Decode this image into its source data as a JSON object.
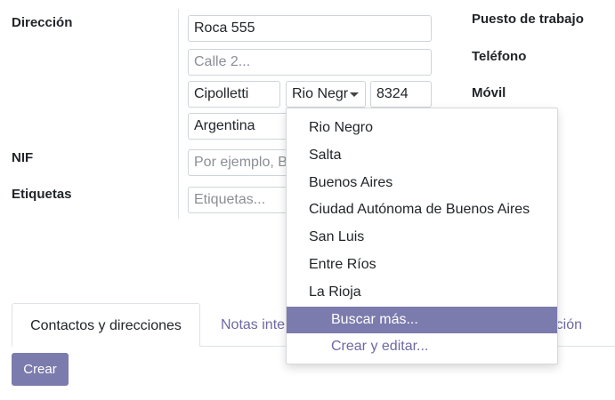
{
  "labels": {
    "direccion": "Dirección",
    "nif": "NIF",
    "etiquetas": "Etiquetas",
    "puesto": "Puesto de trabajo",
    "telefono": "Teléfono",
    "movil": "Móvil"
  },
  "address": {
    "street": "Roca 555",
    "street2_placeholder": "Calle 2...",
    "city": "Cipolletti",
    "state": "Rio Negr",
    "zip": "8324",
    "country": "Argentina"
  },
  "nif": {
    "placeholder": "Por ejemplo, BE0477472701"
  },
  "tags": {
    "placeholder": "Etiquetas..."
  },
  "dropdown": {
    "options": [
      "Rio Negro",
      "Salta",
      "Buenos Aires",
      "Ciudad Autónoma de Buenos Aires",
      "San Luis",
      "Entre Ríos",
      "La Rioja"
    ],
    "search_more": "Buscar más...",
    "create_edit": "Crear y editar..."
  },
  "tabs": {
    "contacts": "Contactos y direcciones",
    "notes": "Notas internas",
    "other": "Compras e información"
  },
  "buttons": {
    "crear": "Crear"
  },
  "colors": {
    "accent": "#7c7bad",
    "link": "#6f68a3"
  }
}
